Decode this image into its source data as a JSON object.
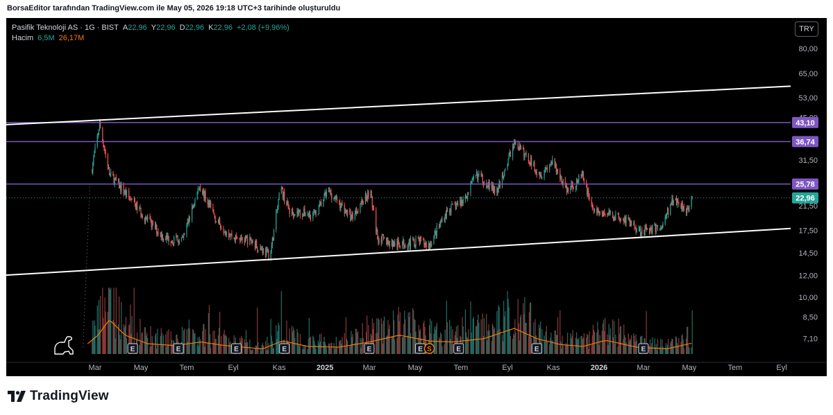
{
  "caption": "BorsaEditor tarafından TradingView.com ile May 05, 2026 19:18 UTC+3 tarihinde oluşturuldu",
  "brand": "TradingView",
  "currency": "TRY",
  "legend": {
    "symbol": "Pasifik Teknoloji AS · 1G · BIST",
    "open_label": "A",
    "open": "22,96",
    "high_label": "Y",
    "high": "22,96",
    "low_label": "D",
    "low": "22,96",
    "close_label": "K",
    "close": "22,96",
    "change": "+2,08 (+9,96%)",
    "volume_label": "Hacim",
    "volume": "6,5M",
    "volume_ma": "26,17M"
  },
  "colors": {
    "background": "#000000",
    "up": "#26a69a",
    "down": "#ef5350",
    "volume_ma": "#f57c00",
    "level_line": "#7e57c2",
    "level_label_bg": "#7e57c2",
    "last_price_bg": "#26a69a",
    "channel": "#ffffff",
    "earnings_marker": "#ffffff",
    "dividend_marker": "#f57c00"
  },
  "chart_data": {
    "type": "candlestick",
    "scale": "log",
    "y_ticks": [
      {
        "value": 80,
        "label": "80,00"
      },
      {
        "value": 65,
        "label": "65,00"
      },
      {
        "value": 53,
        "label": "53,00"
      },
      {
        "value": 45,
        "label": "45,00"
      },
      {
        "value": 31.5,
        "label": "31,50"
      },
      {
        "value": 21.5,
        "label": "21,50"
      },
      {
        "value": 17.5,
        "label": "17,50"
      },
      {
        "value": 14.5,
        "label": "14,50"
      },
      {
        "value": 12,
        "label": "12,00"
      },
      {
        "value": 10,
        "label": "10,00"
      },
      {
        "value": 8.5,
        "label": "8,50"
      },
      {
        "value": 7.1,
        "label": "7,10"
      }
    ],
    "x_ticks": [
      {
        "date": "2024-03-01",
        "label": "Mar",
        "bold": false
      },
      {
        "date": "2024-05-01",
        "label": "May",
        "bold": false
      },
      {
        "date": "2024-07-01",
        "label": "Tem",
        "bold": false
      },
      {
        "date": "2024-09-01",
        "label": "Eyl",
        "bold": false
      },
      {
        "date": "2024-11-01",
        "label": "Kas",
        "bold": false
      },
      {
        "date": "2025-01-01",
        "label": "2025",
        "bold": true
      },
      {
        "date": "2025-03-01",
        "label": "Mar",
        "bold": false
      },
      {
        "date": "2025-05-01",
        "label": "May",
        "bold": false
      },
      {
        "date": "2025-07-01",
        "label": "Tem",
        "bold": false
      },
      {
        "date": "2025-09-01",
        "label": "Eyl",
        "bold": false
      },
      {
        "date": "2025-11-01",
        "label": "Kas",
        "bold": false
      },
      {
        "date": "2026-01-01",
        "label": "2026",
        "bold": true
      },
      {
        "date": "2026-03-01",
        "label": "Mar",
        "bold": false
      },
      {
        "date": "2026-05-01",
        "label": "May",
        "bold": false
      },
      {
        "date": "2026-07-01",
        "label": "Tem",
        "bold": false
      },
      {
        "date": "2026-09-01",
        "label": "Eyl",
        "bold": false
      }
    ],
    "horizontal_levels": [
      {
        "value": 43.1,
        "label": "43,10"
      },
      {
        "value": 36.74,
        "label": "36,74"
      },
      {
        "value": 25.78,
        "label": "25,78"
      }
    ],
    "last_price": {
      "value": 22.96,
      "label": "22,96"
    },
    "trend_lines": [
      {
        "name": "upper",
        "points": [
          {
            "date": "2024-01-01",
            "value": 43.1
          },
          {
            "date": "2026-10-01",
            "value": 58.7
          }
        ]
      },
      {
        "name": "lower",
        "points": [
          {
            "date": "2024-01-01",
            "value": 12.3
          },
          {
            "date": "2026-10-01",
            "value": 17.9
          }
        ]
      }
    ],
    "price_path": [
      {
        "date": "2024-02-25",
        "value": 28.5
      },
      {
        "date": "2024-03-07",
        "value": 42.5
      },
      {
        "date": "2024-03-20",
        "value": 28.0
      },
      {
        "date": "2024-04-10",
        "value": 24.0
      },
      {
        "date": "2024-05-10",
        "value": 19.0
      },
      {
        "date": "2024-06-01",
        "value": 16.5
      },
      {
        "date": "2024-06-25",
        "value": 16.0
      },
      {
        "date": "2024-07-18",
        "value": 25.5
      },
      {
        "date": "2024-08-10",
        "value": 19.0
      },
      {
        "date": "2024-09-01",
        "value": 16.5
      },
      {
        "date": "2024-09-25",
        "value": 16.0
      },
      {
        "date": "2024-10-20",
        "value": 14.2
      },
      {
        "date": "2024-11-03",
        "value": 25.0
      },
      {
        "date": "2024-11-15",
        "value": 20.5
      },
      {
        "date": "2024-12-20",
        "value": 20.0
      },
      {
        "date": "2025-01-05",
        "value": 24.5
      },
      {
        "date": "2025-02-05",
        "value": 19.5
      },
      {
        "date": "2025-03-02",
        "value": 24.5
      },
      {
        "date": "2025-03-12",
        "value": 16.5
      },
      {
        "date": "2025-04-05",
        "value": 15.5
      },
      {
        "date": "2025-05-05",
        "value": 16.0
      },
      {
        "date": "2025-05-20",
        "value": 15.5
      },
      {
        "date": "2025-06-12",
        "value": 20.5
      },
      {
        "date": "2025-07-05",
        "value": 22.5
      },
      {
        "date": "2025-07-22",
        "value": 28.0
      },
      {
        "date": "2025-08-18",
        "value": 24.0
      },
      {
        "date": "2025-09-10",
        "value": 36.5
      },
      {
        "date": "2025-09-28",
        "value": 32.0
      },
      {
        "date": "2025-10-15",
        "value": 28.0
      },
      {
        "date": "2025-10-30",
        "value": 31.0
      },
      {
        "date": "2025-11-20",
        "value": 24.5
      },
      {
        "date": "2025-12-10",
        "value": 27.5
      },
      {
        "date": "2025-12-25",
        "value": 20.5
      },
      {
        "date": "2026-02-01",
        "value": 19.5
      },
      {
        "date": "2026-02-25",
        "value": 17.5
      },
      {
        "date": "2026-03-25",
        "value": 18.0
      },
      {
        "date": "2026-04-10",
        "value": 22.8
      },
      {
        "date": "2026-04-28",
        "value": 20.9
      },
      {
        "date": "2026-05-05",
        "value": 22.96
      }
    ],
    "volume_ma_path": [
      {
        "date": "2024-02-20",
        "value": 0.3
      },
      {
        "date": "2024-03-05",
        "value": 0.55
      },
      {
        "date": "2024-03-20",
        "value": 1.0
      },
      {
        "date": "2024-04-10",
        "value": 0.55
      },
      {
        "date": "2024-05-10",
        "value": 0.3
      },
      {
        "date": "2024-06-15",
        "value": 0.25
      },
      {
        "date": "2024-07-20",
        "value": 0.35
      },
      {
        "date": "2024-08-20",
        "value": 0.25
      },
      {
        "date": "2024-10-10",
        "value": 0.15
      },
      {
        "date": "2024-11-05",
        "value": 0.38
      },
      {
        "date": "2024-12-10",
        "value": 0.22
      },
      {
        "date": "2025-01-20",
        "value": 0.2
      },
      {
        "date": "2025-03-01",
        "value": 0.35
      },
      {
        "date": "2025-04-10",
        "value": 0.55
      },
      {
        "date": "2025-05-20",
        "value": 0.38
      },
      {
        "date": "2025-06-20",
        "value": 0.35
      },
      {
        "date": "2025-08-01",
        "value": 0.45
      },
      {
        "date": "2025-09-10",
        "value": 0.75
      },
      {
        "date": "2025-10-10",
        "value": 0.45
      },
      {
        "date": "2025-11-10",
        "value": 0.28
      },
      {
        "date": "2025-12-10",
        "value": 0.22
      },
      {
        "date": "2026-01-10",
        "value": 0.4
      },
      {
        "date": "2026-02-20",
        "value": 0.2
      },
      {
        "date": "2026-04-01",
        "value": 0.15
      },
      {
        "date": "2026-05-05",
        "value": 0.32
      }
    ],
    "event_markers": [
      {
        "date": "2024-04-20",
        "label": "E",
        "kind": "earnings"
      },
      {
        "date": "2024-06-20",
        "label": "E",
        "kind": "earnings"
      },
      {
        "date": "2024-09-05",
        "label": "E",
        "kind": "earnings"
      },
      {
        "date": "2024-11-08",
        "label": "E",
        "kind": "earnings"
      },
      {
        "date": "2025-03-01",
        "label": "E",
        "kind": "earnings"
      },
      {
        "date": "2025-05-08",
        "label": "E",
        "kind": "earnings"
      },
      {
        "date": "2025-05-20",
        "label": "S",
        "kind": "dividend"
      },
      {
        "date": "2025-06-28",
        "label": "E",
        "kind": "earnings"
      },
      {
        "date": "2025-10-10",
        "label": "E",
        "kind": "earnings"
      },
      {
        "date": "2026-03-01",
        "label": "E",
        "kind": "earnings"
      }
    ],
    "annotations": [
      "dinosaur-replay-icon"
    ]
  }
}
